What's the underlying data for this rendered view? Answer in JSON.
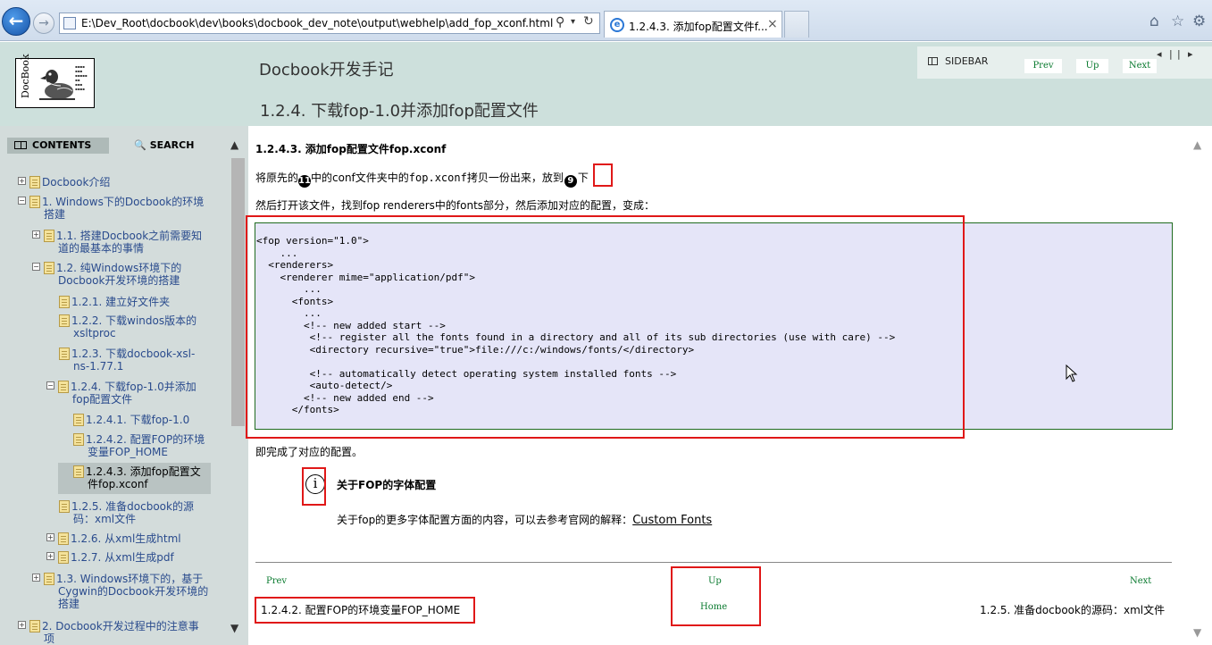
{
  "browser": {
    "address": "E:\\Dev_Root\\docbook\\dev\\books\\docbook_dev_note\\output\\webhelp\\add_fop_xconf.html",
    "tab_title": "1.2.4.3. 添加fop配置文件f...",
    "tab_close": "×"
  },
  "header": {
    "book_title": "Docbook开发手记",
    "section_title": "1.2.4. 下载fop-1.0并添加fop配置文件",
    "sidebar_label": "SIDEBAR",
    "prev": "Prev",
    "up": "Up",
    "next": "Next"
  },
  "sidebar": {
    "contents_tab": "CONTENTS",
    "search_tab": "SEARCH",
    "toc": [
      {
        "label": "Docbook介绍"
      },
      {
        "label": "1. Windows下的Docbook的环境",
        "label2": "搭建"
      },
      {
        "label": "1.1. 搭建Docbook之前需要知",
        "label2": "道的最基本的事情"
      },
      {
        "label": "1.2. 纯Windows环境下的",
        "label2": "Docbook开发环境的搭建"
      },
      {
        "label": "1.2.1. 建立好文件夹"
      },
      {
        "label": "1.2.2. 下载windos版本的",
        "label2": "xsltproc"
      },
      {
        "label": "1.2.3. 下载docbook-xsl-",
        "label2": "ns-1.77.1"
      },
      {
        "label": "1.2.4. 下载fop-1.0并添加",
        "label2": "fop配置文件"
      },
      {
        "label": "1.2.4.1. 下载fop-1.0"
      },
      {
        "label": "1.2.4.2. 配置FOP的环境",
        "label2": "变量FOP_HOME"
      },
      {
        "label": "1.2.4.3. 添加fop配置文",
        "label2": "件fop.xconf"
      },
      {
        "label": "1.2.5. 准备docbook的源",
        "label2": "码：xml文件"
      },
      {
        "label": "1.2.6. 从xml生成html"
      },
      {
        "label": "1.2.7. 从xml生成pdf"
      },
      {
        "label": "1.3. Windows环境下的，基于",
        "label2": "Cygwin的Docbook开发环境的",
        "label3": "搭建"
      },
      {
        "label": "2. Docbook开发过程中的注意事",
        "label2": "项"
      }
    ]
  },
  "content": {
    "heading": "1.2.4.3. 添加fop配置文件fop.xconf",
    "para1_a": "将原先的",
    "callout1": "11",
    "para1_b": "中的conf文件夹中的",
    "para1_code": "fop.xconf",
    "para1_c": "拷贝一份出来，放到",
    "callout2": "9",
    "para1_d": "下",
    "para2": "然后打开该文件，找到fop  renderers中的fonts部分，然后添加对应的配置，变成：",
    "code": "<fop version=\"1.0\">\n    ...\n  <renderers>\n    <renderer mime=\"application/pdf\">\n        ...\n      <fonts>\n        ...\n        <!-- new added start -->\n         <!-- register all the fonts found in a directory and all of its sub directories (use with care) -->\n         <directory recursive=\"true\">file:///c:/windows/fonts/</directory>\n\n         <!-- automatically detect operating system installed fonts -->\n         <auto-detect/>\n        <!-- new added end -->\n      </fonts>",
    "para3": "即完成了对应的配置。",
    "note_title": "关于FOP的字体配置",
    "note_body": "关于fop的更多字体配置方面的内容，可以去参考官网的解释：",
    "note_link": "Custom Fonts"
  },
  "footer": {
    "prev": "Prev",
    "up": "Up",
    "next": "Next",
    "home": "Home",
    "prev_title": "1.2.4.2. 配置FOP的环境变量FOP_HOME",
    "next_title": "1.2.5. 准备docbook的源码：xml文件"
  },
  "colors": {
    "header_bg": "#cde0dc",
    "sidebar_bg": "#d3dcdb",
    "code_bg": "#e5e5f8",
    "nav_green": "#0a7a2f",
    "toc_link": "#2a4b8d",
    "highlight_red": "#e01818"
  }
}
